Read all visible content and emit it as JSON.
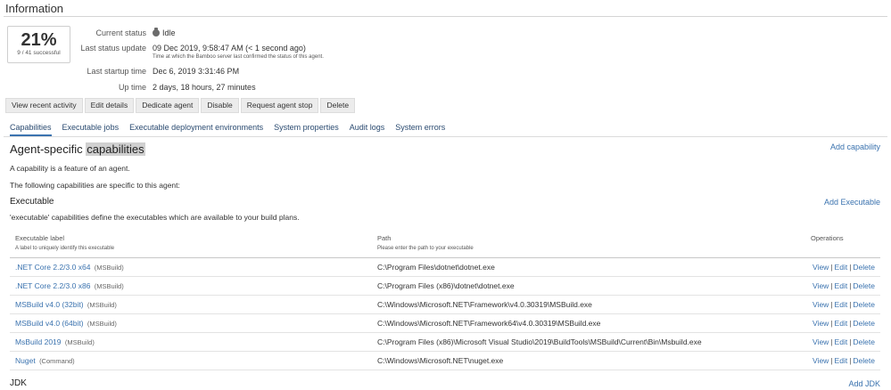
{
  "page": {
    "title": "Information"
  },
  "stats": {
    "percent": "21%",
    "summary": "9 / 41 successful"
  },
  "status": {
    "current_status_label": "Current status",
    "current_status_value": "Idle",
    "last_update_label": "Last status update",
    "last_update_value": "09 Dec 2019, 9:58:47 AM (< 1 second ago)",
    "last_update_note": "Time at which the Bamboo server last confirmed the status of this agent.",
    "last_startup_label": "Last startup time",
    "last_startup_value": "Dec 6, 2019 3:31:46 PM",
    "uptime_label": "Up time",
    "uptime_value": "2 days, 18 hours, 27 minutes"
  },
  "actions": [
    "View recent activity",
    "Edit details",
    "Dedicate agent",
    "Disable",
    "Request agent stop",
    "Delete"
  ],
  "tabs": [
    "Capabilities",
    "Executable jobs",
    "Executable deployment environments",
    "System properties",
    "Audit logs",
    "System errors"
  ],
  "capabilities": {
    "heading_prefix": "Agent-specific",
    "heading_highlight": "capabilities",
    "add_capability": "Add capability",
    "intro": "A capability is a feature of an agent.",
    "intro2": "The following capabilities are specific to this agent:"
  },
  "executable": {
    "heading": "Executable",
    "add_label": "Add Executable",
    "description": "'executable' capabilities define the executables which are available to your build plans.",
    "columns": {
      "label": "Executable label",
      "label_hint": "A label to uniquely identify this executable",
      "path": "Path",
      "path_hint": "Please enter the path to your executable",
      "operations": "Operations"
    },
    "ops": {
      "view": "View",
      "edit": "Edit",
      "delete": "Delete",
      "separator": "|"
    },
    "rows": [
      {
        "label": ".NET Core 2.2/3.0 x64",
        "type": "(MSBuild)",
        "path": "C:\\Program Files\\dotnet\\dotnet.exe"
      },
      {
        "label": ".NET Core 2.2/3.0 x86",
        "type": "(MSBuild)",
        "path": "C:\\Program Files (x86)\\dotnet\\dotnet.exe"
      },
      {
        "label": "MSBuild v4.0 (32bit)",
        "type": "(MSBuild)",
        "path": "C:\\Windows\\Microsoft.NET\\Framework\\v4.0.30319\\MSBuild.exe"
      },
      {
        "label": "MSBuild v4.0 (64bit)",
        "type": "(MSBuild)",
        "path": "C:\\Windows\\Microsoft.NET\\Framework64\\v4.0.30319\\MSBuild.exe"
      },
      {
        "label": "MsBuild 2019",
        "type": "(MSBuild)",
        "path": "C:\\Program Files (x86)\\Microsoft Visual Studio\\2019\\BuildTools\\MSBuild\\Current\\Bin\\Msbuild.exe"
      },
      {
        "label": "Nuget",
        "type": "(Command)",
        "path": "C:\\Windows\\Microsoft.NET\\nuget.exe"
      }
    ]
  },
  "jdk": {
    "heading": "JDK",
    "add_label": "Add JDK"
  },
  "colors": {
    "link": "#3b73af",
    "tab_underline": "#3b73af",
    "button_bg": "#ececec"
  }
}
